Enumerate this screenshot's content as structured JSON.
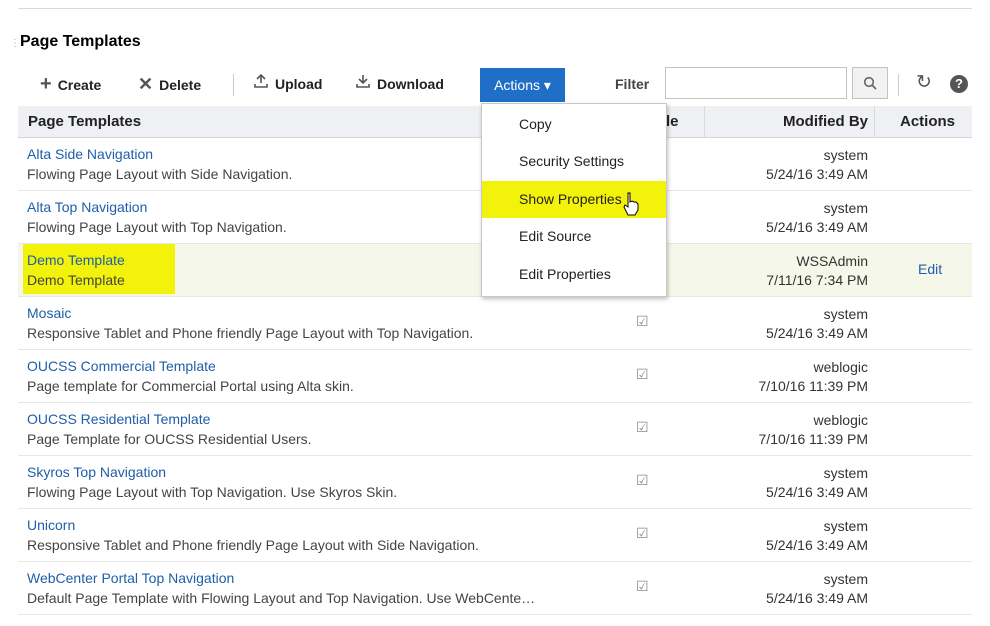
{
  "panel": {
    "title": "Page Templates"
  },
  "toolbar": {
    "create_label": "Create",
    "delete_label": "Delete",
    "upload_label": "Upload",
    "download_label": "Download",
    "actions_label": "Actions ▾",
    "filter_label": "Filter",
    "filter_value": "",
    "icons": [
      "plus-icon",
      "delete-x-icon",
      "upload-icon",
      "download-icon",
      "search-icon",
      "refresh-icon",
      "help-icon"
    ]
  },
  "table": {
    "columns": {
      "name": "Page Templates",
      "available": "le",
      "modified_by": "Modified By",
      "actions": "Actions"
    },
    "rows": [
      {
        "name": "Alta Side Navigation",
        "desc": "Flowing Page Layout with Side Navigation.",
        "available": false,
        "modified_by": "system",
        "modified_at": "5/24/16 3:49 AM",
        "action": ""
      },
      {
        "name": "Alta Top Navigation",
        "desc": "Flowing Page Layout with Top Navigation.",
        "available": false,
        "modified_by": "system",
        "modified_at": "5/24/16 3:49 AM",
        "action": ""
      },
      {
        "name": "Demo Template",
        "desc": "Demo Template",
        "available": false,
        "modified_by": "WSSAdmin",
        "modified_at": "7/11/16 7:34 PM",
        "action": "Edit",
        "selected": true
      },
      {
        "name": "Mosaic",
        "desc": "Responsive Tablet and Phone friendly Page Layout with Top Navigation.",
        "available": true,
        "modified_by": "system",
        "modified_at": "5/24/16 3:49 AM",
        "action": ""
      },
      {
        "name": "OUCSS Commercial Template",
        "desc": "Page template for Commercial Portal using Alta skin.",
        "available": true,
        "modified_by": "weblogic",
        "modified_at": "7/10/16 11:39 PM",
        "action": ""
      },
      {
        "name": "OUCSS Residential Template",
        "desc": "Page Template for OUCSS Residential Users.",
        "available": true,
        "modified_by": "weblogic",
        "modified_at": "7/10/16 11:39 PM",
        "action": ""
      },
      {
        "name": "Skyros Top Navigation",
        "desc": "Flowing Page Layout with Top Navigation. Use Skyros Skin.",
        "available": true,
        "modified_by": "system",
        "modified_at": "5/24/16 3:49 AM",
        "action": ""
      },
      {
        "name": "Unicorn",
        "desc": "Responsive Tablet and Phone friendly Page Layout with Side Navigation.",
        "available": true,
        "modified_by": "system",
        "modified_at": "5/24/16 3:49 AM",
        "action": ""
      },
      {
        "name": "WebCenter Portal Top Navigation",
        "desc": "Default Page Template with Flowing Layout and Top Navigation. Use WebCente…",
        "available": true,
        "modified_by": "system",
        "modified_at": "5/24/16 3:49 AM",
        "action": ""
      }
    ]
  },
  "actions_menu": {
    "items": [
      "Copy",
      "Security Settings",
      "Show Properties",
      "Edit Source",
      "Edit Properties"
    ],
    "highlighted": "Show Properties"
  },
  "colors": {
    "accent": "#1f6fc9",
    "link": "#1f5ea8",
    "highlight": "#f2f20a",
    "selected_row": "#f5f7e8"
  }
}
